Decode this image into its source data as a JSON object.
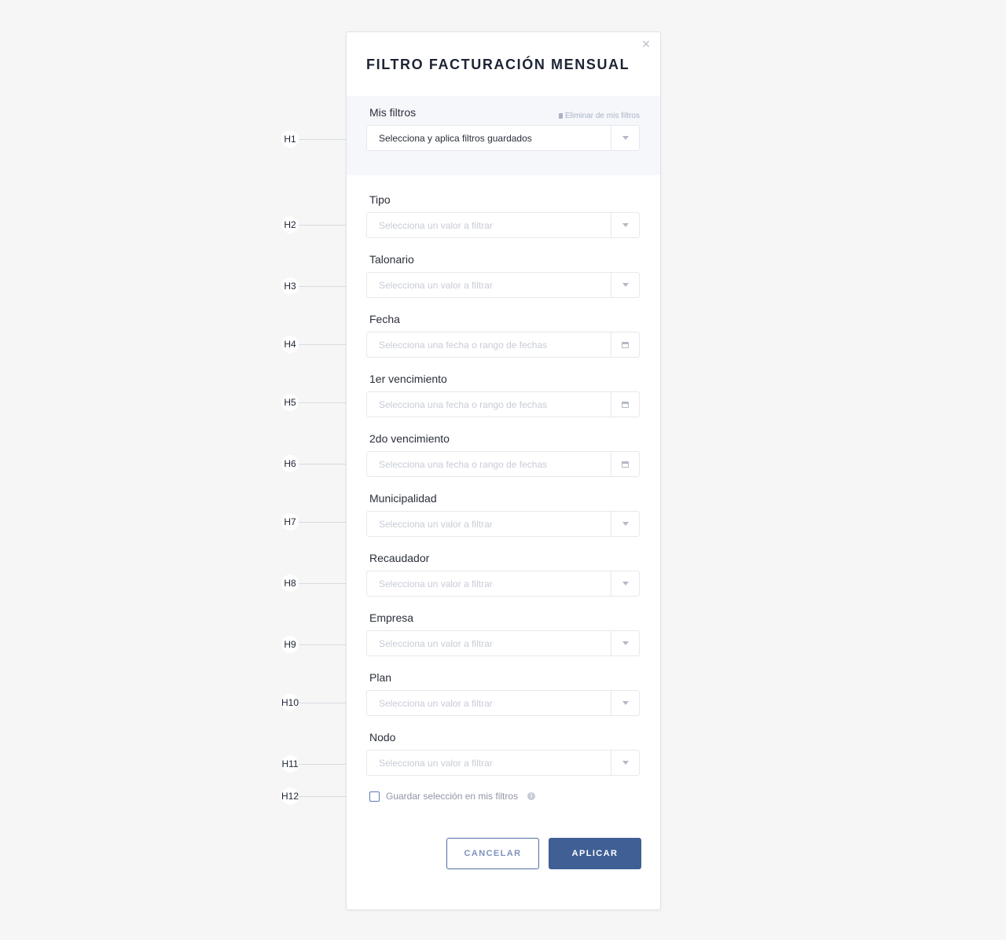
{
  "modal": {
    "title": "FILTRO FACTURACIÓN MENSUAL",
    "close_icon": "×"
  },
  "saved_filters": {
    "label": "Mis filtros",
    "delete_link": "Eliminar de mis filtros",
    "select_value": "Selecciona y aplica filtros guardados"
  },
  "fields": [
    {
      "label": "Tipo",
      "placeholder": "Selecciona un valor a filtrar",
      "addon_icon": "chevron-down-icon"
    },
    {
      "label": "Talonario",
      "placeholder": "Selecciona un valor a filtrar",
      "addon_icon": "chevron-down-icon"
    },
    {
      "label": "Fecha",
      "placeholder": "Selecciona una fecha o rango de fechas",
      "addon_icon": "calendar-icon"
    },
    {
      "label": "1er vencimiento",
      "placeholder": "Selecciona una fecha o rango de fechas",
      "addon_icon": "calendar-icon"
    },
    {
      "label": "2do vencimiento",
      "placeholder": "Selecciona una fecha o rango de fechas",
      "addon_icon": "calendar-icon"
    },
    {
      "label": "Municipalidad",
      "placeholder": "Selecciona un valor a filtrar",
      "addon_icon": "chevron-down-icon"
    },
    {
      "label": "Recaudador",
      "placeholder": "Selecciona un valor a filtrar",
      "addon_icon": "chevron-down-icon"
    },
    {
      "label": "Empresa",
      "placeholder": "Selecciona un valor a filtrar",
      "addon_icon": "chevron-down-icon"
    },
    {
      "label": "Plan",
      "placeholder": "Selecciona un valor a filtrar",
      "addon_icon": "chevron-down-icon"
    },
    {
      "label": "Nodo",
      "placeholder": "Selecciona un valor a filtrar",
      "addon_icon": "chevron-down-icon"
    }
  ],
  "save_selection": {
    "label": "Guardar selección en mis filtros",
    "checked": false,
    "info_icon": "info-icon"
  },
  "buttons": {
    "cancel": "CANCELAR",
    "apply": "APLICAR"
  },
  "hints": [
    "H1",
    "H2",
    "H3",
    "H4",
    "H5",
    "H6",
    "H7",
    "H8",
    "H9",
    "H10",
    "H11",
    "H12"
  ],
  "colors": {
    "primary": "#3f5f95",
    "title": "#1c2434",
    "placeholder": "#c8ccd6",
    "panel": "#f6f7fb"
  }
}
